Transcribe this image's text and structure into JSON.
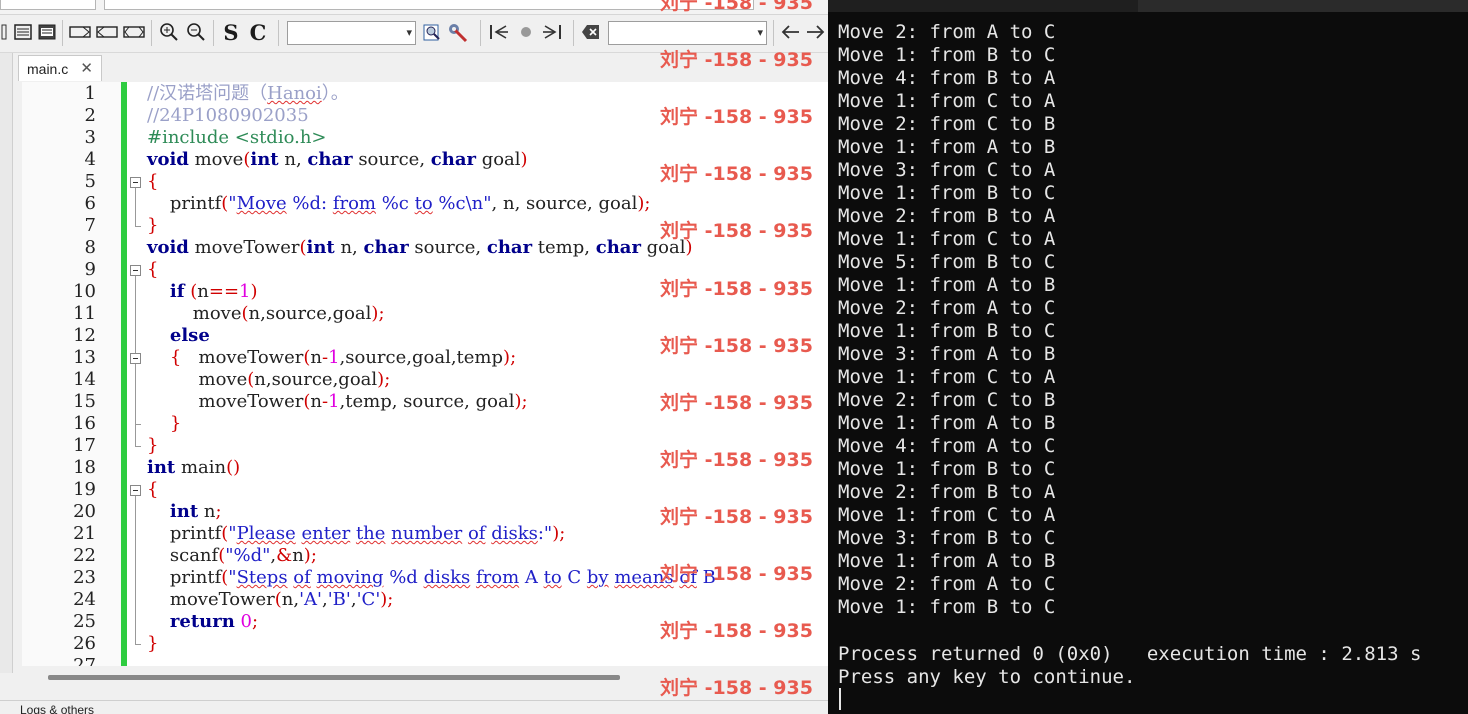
{
  "editor": {
    "tab_title": "main.c",
    "tab_close": "✕",
    "line_numbers": [
      "1",
      "2",
      "3",
      "4",
      "5",
      "6",
      "7",
      "8",
      "9",
      "10",
      "11",
      "12",
      "13",
      "14",
      "15",
      "16",
      "17",
      "18",
      "19",
      "20",
      "21",
      "22",
      "23",
      "24",
      "25",
      "26",
      "27"
    ],
    "lines": [
      "//汉诺塔问题（Hanoi）。",
      "//24P1080902035",
      "#include <stdio.h>",
      "void move(int n, char source, char goal)",
      "{",
      "    printf(\"Move %d: from %c to %c\\n\", n, source, goal);",
      "}",
      "void moveTower(int n, char source, char temp, char goal)",
      "{",
      "    if (n==1)",
      "        move(n,source,goal);",
      "    else",
      "    {   moveTower(n-1,source,goal,temp);",
      "         move(n,source,goal);",
      "         moveTower(n-1,temp, source, goal);",
      "    }",
      "}",
      "int main()",
      "{",
      "    int n;",
      "    printf(\"Please enter the number of disks:\");",
      "    scanf(\"%d\",&n);",
      "    printf(\"Steps of moving %d disks from A to C by means of B",
      "    moveTower(n,'A','B','C');",
      "    return 0;",
      "}"
    ]
  },
  "toolbar": {
    "s_label": "S",
    "c_label": "C",
    "combo1_arrow": "▾",
    "combo2_arrow": "▾"
  },
  "logs_label": "Logs & others",
  "watermark": "刘宁 -158 - 935",
  "console": {
    "moves": [
      "Move 2: from A to C",
      "Move 1: from B to C",
      "Move 4: from B to A",
      "Move 1: from C to A",
      "Move 2: from C to B",
      "Move 1: from A to B",
      "Move 3: from C to A",
      "Move 1: from B to C",
      "Move 2: from B to A",
      "Move 1: from C to A",
      "Move 5: from B to C",
      "Move 1: from A to B",
      "Move 2: from A to C",
      "Move 1: from B to C",
      "Move 3: from A to B",
      "Move 1: from C to A",
      "Move 2: from C to B",
      "Move 1: from A to B",
      "Move 4: from A to C",
      "Move 1: from B to C",
      "Move 2: from B to A",
      "Move 1: from C to A",
      "Move 3: from B to C",
      "Move 1: from A to B",
      "Move 2: from A to C",
      "Move 1: from B to C"
    ],
    "process_line": "Process returned 0 (0x0)   execution time : 2.813 s",
    "press_line": "Press any key to continue."
  },
  "colors": {
    "keyword": "#00008b",
    "comment": "#9aa0c8",
    "string": "#2020c8",
    "operator": "#d00000",
    "number": "#e000e0",
    "change_bar": "#2ecc40",
    "watermark": "#e85a4f",
    "console_bg": "#0c0c0c"
  }
}
